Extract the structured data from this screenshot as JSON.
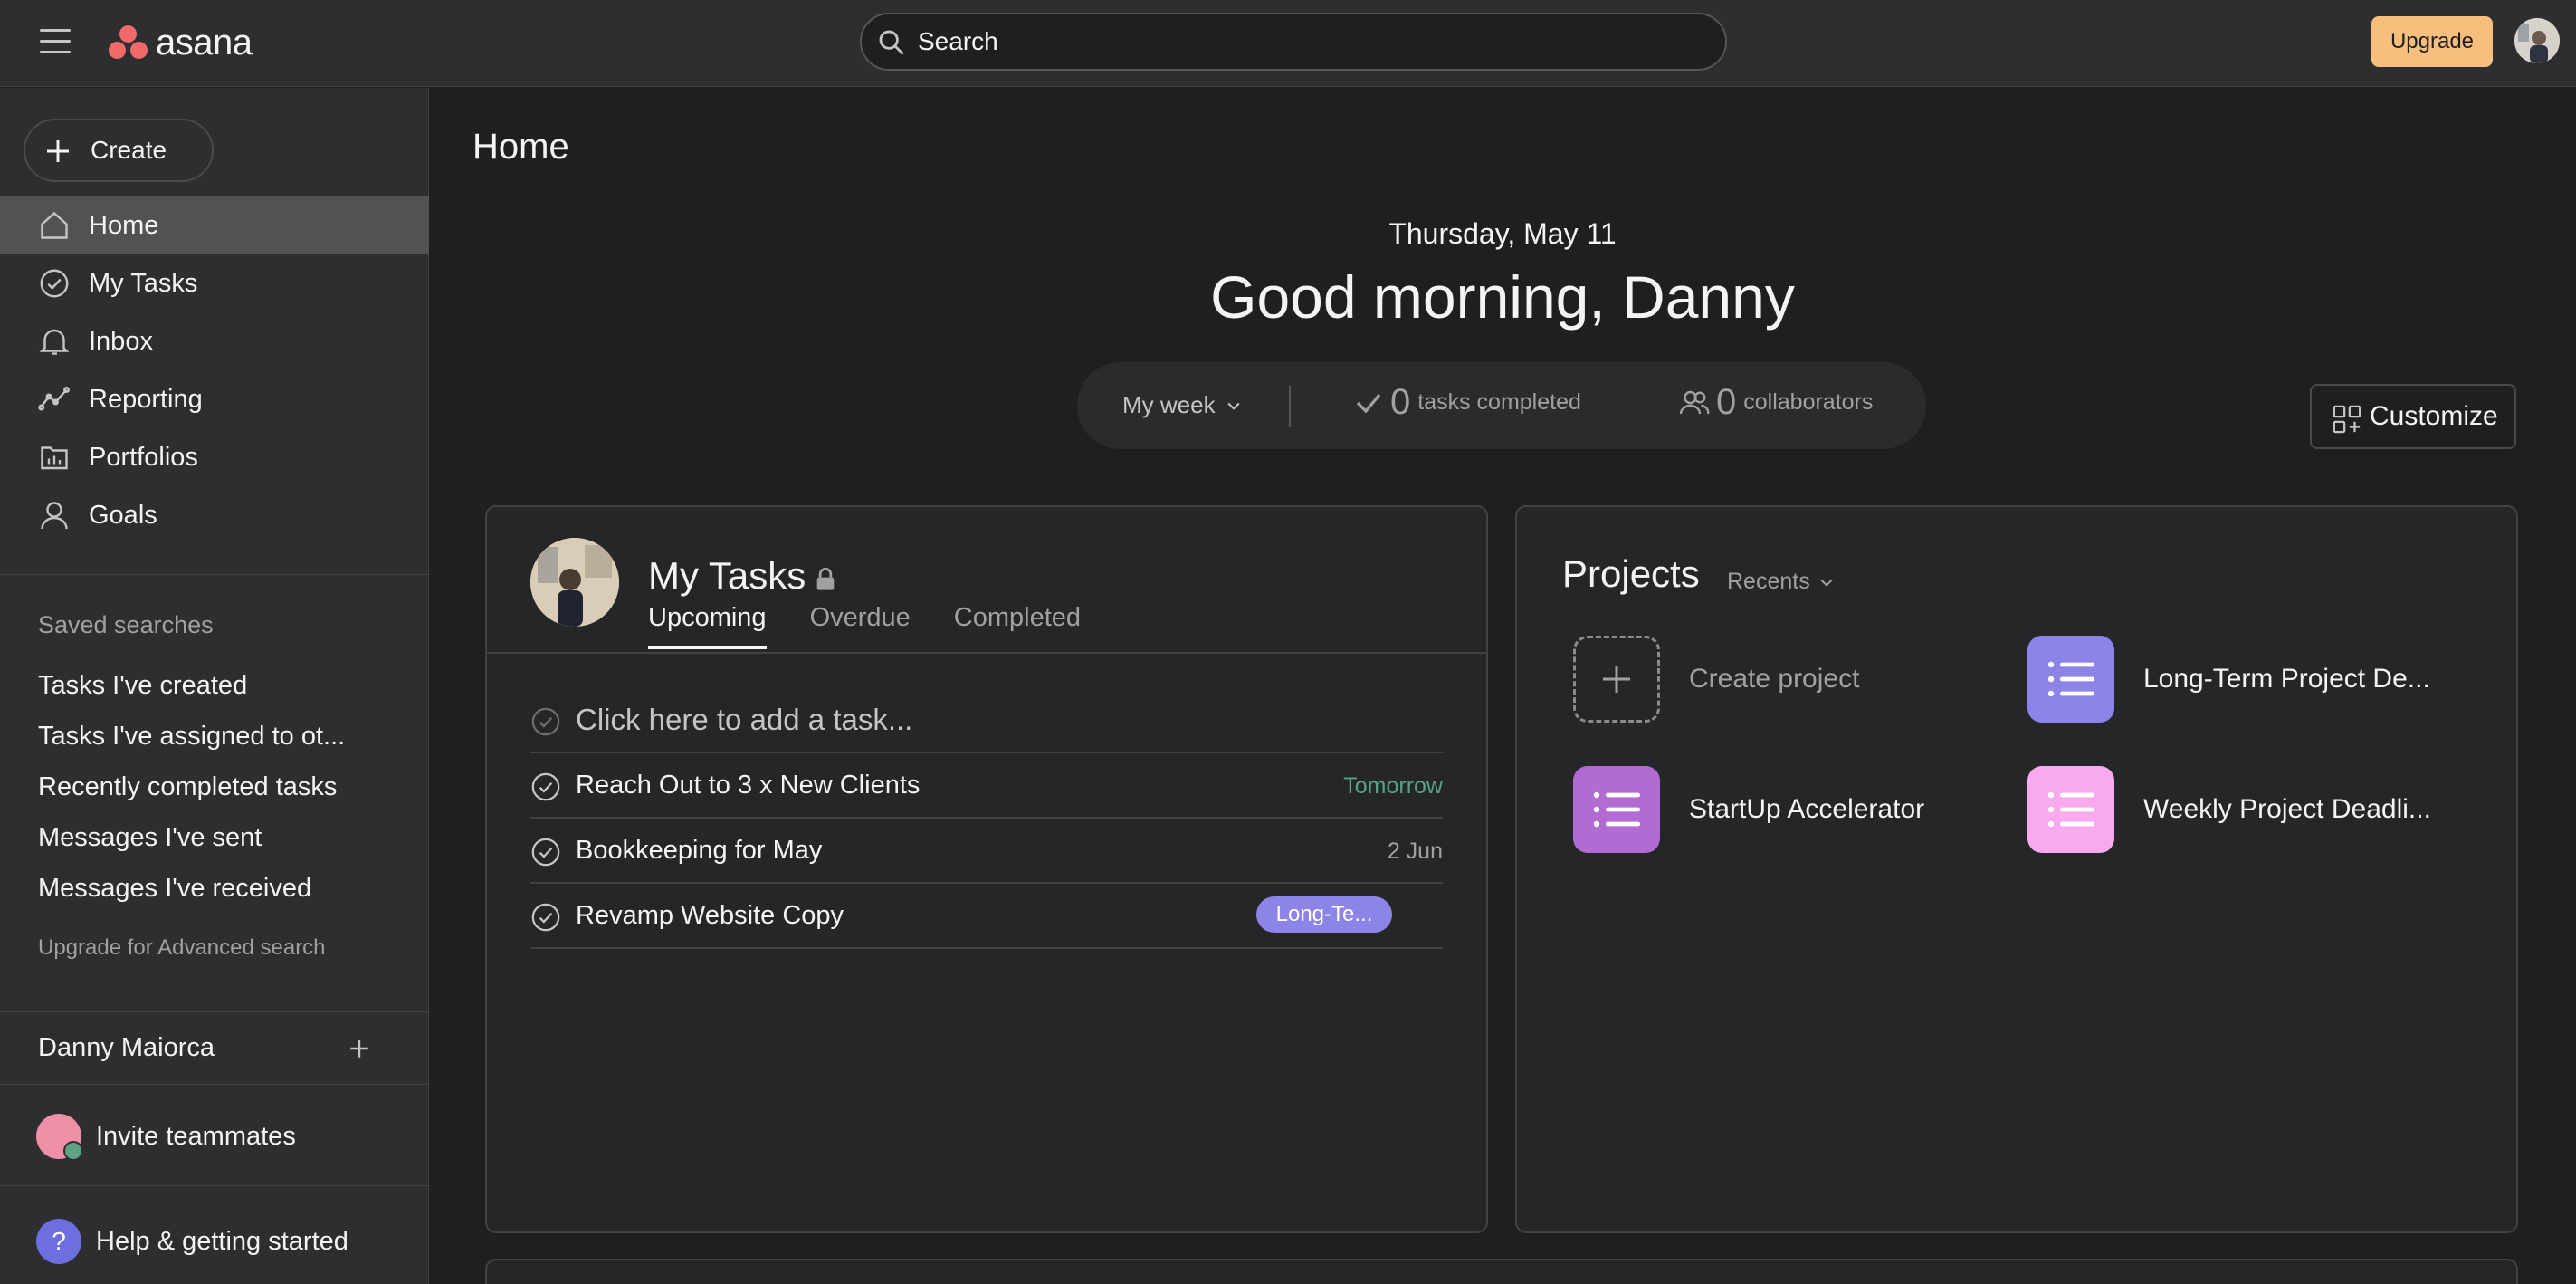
{
  "topbar": {
    "logo_text": "asana",
    "search_placeholder": "Search",
    "upgrade_label": "Upgrade"
  },
  "sidebar": {
    "create_label": "Create",
    "nav": [
      {
        "label": "Home",
        "icon": "home-icon",
        "active": true
      },
      {
        "label": "My Tasks",
        "icon": "check-circle-icon"
      },
      {
        "label": "Inbox",
        "icon": "bell-icon"
      },
      {
        "label": "Reporting",
        "icon": "line-chart-icon"
      },
      {
        "label": "Portfolios",
        "icon": "folder-chart-icon"
      },
      {
        "label": "Goals",
        "icon": "person-icon"
      }
    ],
    "saved_searches_title": "Saved searches",
    "saved_searches": [
      "Tasks I've created",
      "Tasks I've assigned to ot...",
      "Recently completed tasks",
      "Messages I've sent",
      "Messages I've received"
    ],
    "upgrade_search_link": "Upgrade for Advanced search",
    "team_name": "Danny Maiorca",
    "invite_label": "Invite teammates",
    "help_label": "Help & getting started",
    "help_glyph": "?"
  },
  "main": {
    "page_title": "Home",
    "date": "Thursday, May 11",
    "greeting": "Good morning, Danny",
    "stats": {
      "period": "My week",
      "tasks_completed_count": "0",
      "tasks_completed_label": "tasks completed",
      "collaborators_count": "0",
      "collaborators_label": "collaborators"
    },
    "customize_label": "Customize"
  },
  "my_tasks": {
    "title": "My Tasks",
    "tabs": [
      "Upcoming",
      "Overdue",
      "Completed"
    ],
    "active_tab": "Upcoming",
    "add_task_placeholder": "Click here to add a task...",
    "tasks": [
      {
        "name": "Reach Out to 3 x New Clients",
        "due": "Tomorrow",
        "due_color": "#58a182"
      },
      {
        "name": "Bookkeeping for May",
        "due": "2 Jun"
      },
      {
        "name": "Revamp Website Copy",
        "project_chip": "Long-Te..."
      }
    ]
  },
  "projects": {
    "title": "Projects",
    "filter": "Recents",
    "items": [
      {
        "name": "Create project",
        "tile": "dashed"
      },
      {
        "name": "Long-Term Project De...",
        "color": "#8d84e8"
      },
      {
        "name": "StartUp Accelerator",
        "color": "#b36bd4"
      },
      {
        "name": "Weekly Project Deadli...",
        "color": "#f9aaef"
      }
    ]
  },
  "colors": {
    "background": "#1e1f21",
    "sidebar": "#2e2e30",
    "accent_upgrade": "#f8be7d",
    "logo_coral": "#f06a6a",
    "due_green": "#58a182"
  }
}
